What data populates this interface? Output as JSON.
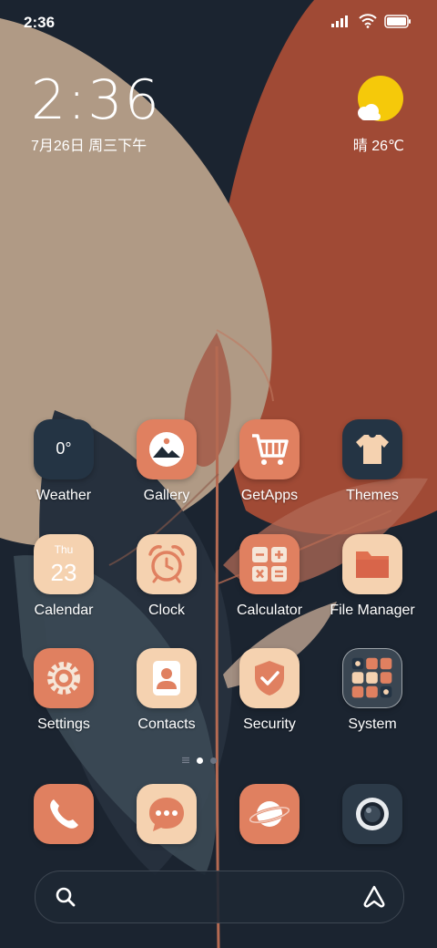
{
  "status_bar": {
    "time": "2:36",
    "icons": [
      "signal-icon",
      "wifi-icon",
      "battery-icon"
    ]
  },
  "clock_widget": {
    "time": "2:36",
    "date": "7月26日 周三下午"
  },
  "weather_widget": {
    "icon": "sun-cloud-icon",
    "text": "晴 26℃"
  },
  "apps": [
    {
      "label": "Weather",
      "icon": "weather-icon",
      "value": "0°"
    },
    {
      "label": "Gallery",
      "icon": "gallery-icon"
    },
    {
      "label": "GetApps",
      "icon": "cart-icon"
    },
    {
      "label": "Themes",
      "icon": "tshirt-icon"
    },
    {
      "label": "Calendar",
      "icon": "calendar-icon",
      "weekday": "Thu",
      "day": "23"
    },
    {
      "label": "Clock",
      "icon": "alarm-clock-icon"
    },
    {
      "label": "Calculator",
      "icon": "calculator-icon"
    },
    {
      "label": "File Manager",
      "icon": "folder-icon"
    },
    {
      "label": "Settings",
      "icon": "gear-icon"
    },
    {
      "label": "Contacts",
      "icon": "contact-icon"
    },
    {
      "label": "Security",
      "icon": "shield-check-icon"
    },
    {
      "label": "System",
      "icon": "folder-grid-icon"
    }
  ],
  "dock": [
    {
      "icon": "phone-icon"
    },
    {
      "icon": "messages-icon"
    },
    {
      "icon": "browser-planet-icon"
    },
    {
      "icon": "camera-icon"
    }
  ],
  "page_indicator": {
    "pages": 3,
    "active": 1
  },
  "search_bar": {
    "placeholder": "",
    "search_icon": "search-icon",
    "assistant_icon": "assistant-icon"
  },
  "colors": {
    "background": "#1b2430",
    "beige_leaf": "#b09a85",
    "rust_leaf": "#a04a35",
    "tile_coral": "#e08060",
    "tile_peach": "#f5d2b0",
    "tile_dark": "#243444",
    "sun": "#f5c90a"
  }
}
